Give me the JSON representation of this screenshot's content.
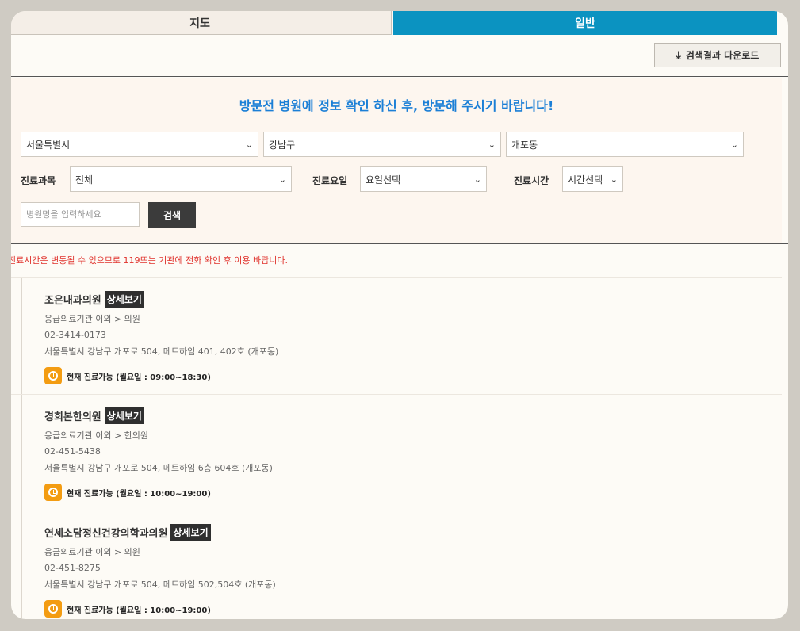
{
  "tabs": {
    "map": "지도",
    "general": "일반"
  },
  "download_label": "검색결과 다운로드",
  "notice_title": "방문전 병원에 정보 확인 하신 후, 방문해 주시기 바랍니다!",
  "region": {
    "city": "서울특별시",
    "district": "강남구",
    "dong": "개포동"
  },
  "filters": {
    "dept_label": "진료과목",
    "dept_value": "전체",
    "day_label": "진료요일",
    "day_value": "요일선택",
    "time_label": "진료시간",
    "time_value": "시간선택"
  },
  "search": {
    "placeholder": "병원명을 입력하세요",
    "button": "검색"
  },
  "warning": "진료시간은 변동될 수 있으므로 119또는 기관에 전화 확인 후 이용 바랍니다.",
  "detail_label": "상세보기",
  "hospitals": [
    {
      "name": "조은내과의원",
      "category": "응급의료기관 이외 > 의원",
      "phone": "02-3414-0173",
      "address": "서울특별시 강남구 개포로 504, 메트하임 401, 402호 (개포동)",
      "status": "현재 진료가능 (월요일 : 09:00~18:30)"
    },
    {
      "name": "경희본한의원",
      "category": "응급의료기관 이외 > 한의원",
      "phone": "02-451-5438",
      "address": "서울특별시 강남구 개포로 504, 메트하임 6층 604호 (개포동)",
      "status": "현재 진료가능 (월요일 : 10:00~19:00)"
    },
    {
      "name": "연세소담정신건강의학과의원",
      "category": "응급의료기관 이외 > 의원",
      "phone": "02-451-8275",
      "address": "서울특별시 강남구 개포로 504, 메트하임 502,504호 (개포동)",
      "status": "현재 진료가능 (월요일 : 10:00~19:00)"
    }
  ]
}
